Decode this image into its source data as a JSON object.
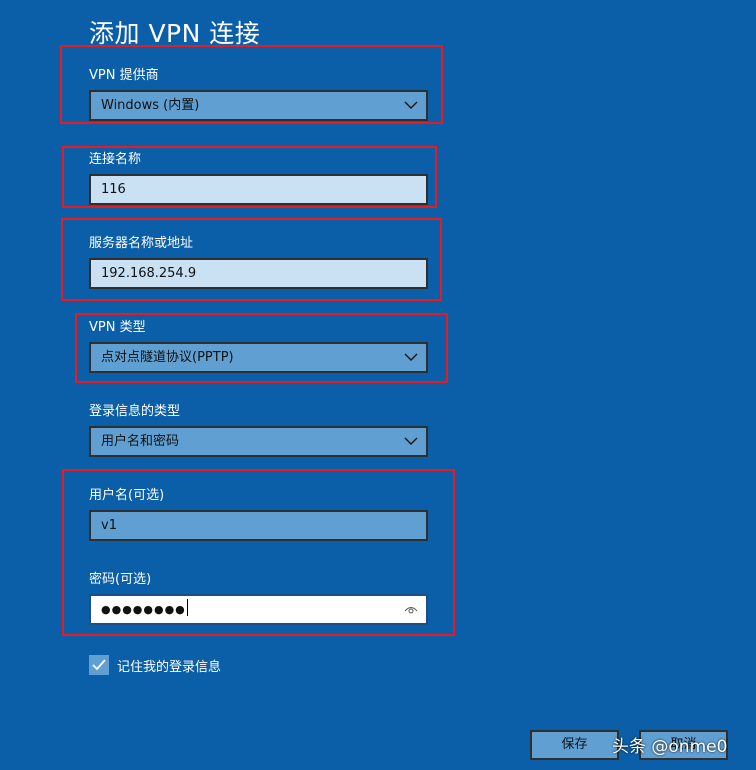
{
  "page": {
    "title": "添加 VPN 连接"
  },
  "fields": {
    "provider": {
      "label": "VPN 提供商",
      "value": "Windows (内置)"
    },
    "connection_name": {
      "label": "连接名称",
      "value": "116"
    },
    "server": {
      "label": "服务器名称或地址",
      "value": "192.168.254.9"
    },
    "vpn_type": {
      "label": "VPN 类型",
      "value": "点对点隧道协议(PPTP)"
    },
    "signin_type": {
      "label": "登录信息的类型",
      "value": "用户名和密码"
    },
    "username": {
      "label": "用户名(可选)",
      "value": "v1"
    },
    "password": {
      "label": "密码(可选)",
      "value": "●●●●●●●●"
    }
  },
  "remember": {
    "label": "记住我的登录信息",
    "checked": true
  },
  "buttons": {
    "save": "保存",
    "cancel": "取消"
  },
  "watermark": "头条 @onme0",
  "colors": {
    "background": "#0b5fa8",
    "highlight": "#e81b23",
    "control": "#5f9fd2"
  }
}
